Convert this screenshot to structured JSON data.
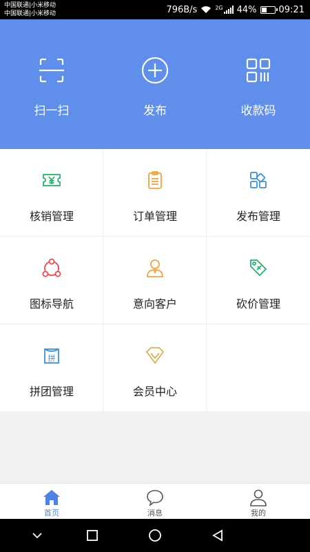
{
  "status_bar": {
    "carrier1": "中国联通|小米移动",
    "carrier2": "中国联通|小米移动",
    "speed": "796B/s",
    "network": "2G",
    "battery": "44%",
    "battery_level": 0.44,
    "time": "09:21"
  },
  "header": {
    "scan_label": "扫一扫",
    "publish_label": "发布",
    "qrcode_label": "收款码",
    "background_color": "#5f8fea"
  },
  "grid": {
    "items": [
      {
        "label": "核销管理",
        "icon": "ticket-yen-icon",
        "color": "#1fb36b"
      },
      {
        "label": "订单管理",
        "icon": "clipboard-icon",
        "color": "#f0a23c"
      },
      {
        "label": "发布管理",
        "icon": "apps-icon",
        "color": "#3a8fd9"
      },
      {
        "label": "图标导航",
        "icon": "nodes-icon",
        "color": "#e84b4b"
      },
      {
        "label": "意向客户",
        "icon": "user-icon",
        "color": "#f0a23c"
      },
      {
        "label": "砍价管理",
        "icon": "price-tag-icon",
        "color": "#1fb36b"
      },
      {
        "label": "拼团管理",
        "icon": "group-buy-icon",
        "color": "#3a8fd9"
      },
      {
        "label": "会员中心",
        "icon": "diamond-icon",
        "color": "#d9b05a"
      }
    ]
  },
  "tabbar": {
    "tabs": [
      {
        "label": "首页",
        "icon": "home-icon",
        "active": true
      },
      {
        "label": "消息",
        "icon": "message-icon",
        "active": false
      },
      {
        "label": "我的",
        "icon": "profile-icon",
        "active": false
      }
    ],
    "active_color": "#4f82e8"
  }
}
